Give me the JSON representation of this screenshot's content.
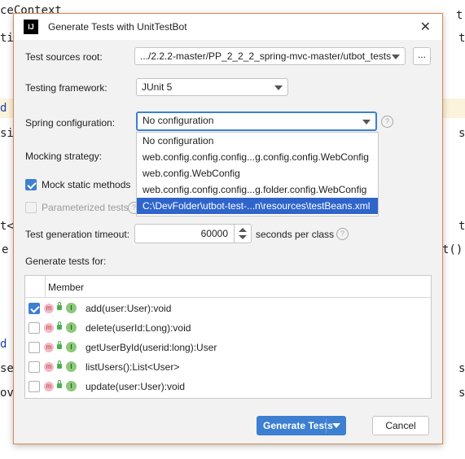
{
  "editor": {
    "fragments": [
      {
        "text": "ceContext"
      },
      {
        "text": "ti"
      },
      {
        "text": "d"
      },
      {
        "text": "si"
      },
      {
        "text": "t<"
      },
      {
        "text": "e"
      },
      {
        "text": "d"
      },
      {
        "text": "se"
      },
      {
        "text": "ov"
      },
      {
        "text": "t"
      },
      {
        "text": "t"
      },
      {
        "text": "s"
      },
      {
        "text": "t"
      },
      {
        "text": "t()"
      },
      {
        "text": "s"
      },
      {
        "text": "s"
      }
    ]
  },
  "dialog": {
    "title": "Generate Tests with UnitTestBot",
    "app_icon": "IJ",
    "close_glyph": "✕",
    "test_sources_root": {
      "label": "Test sources root:",
      "value": ".../2.2.2-master/PP_2_2_2_spring-mvc-master/utbot_tests",
      "browse_label": "..."
    },
    "testing_framework": {
      "label": "Testing framework:",
      "value": "JUnit 5"
    },
    "spring_configuration": {
      "label": "Spring configuration:",
      "value": "No configuration",
      "options": [
        {
          "label": "No configuration"
        },
        {
          "label": "web.config.config.config...g.config.config.WebConfig"
        },
        {
          "label": "web.config.WebConfig"
        },
        {
          "label": "web.config.config.config...g.folder.config.WebConfig"
        },
        {
          "label": "C:\\DevFolder\\utbot-test-...n\\resources\\testBeans.xml"
        }
      ]
    },
    "mocking_strategy": {
      "label": "Mocking strategy:"
    },
    "mock_static_methods": {
      "label": "Mock static methods",
      "checked": true
    },
    "parameterized_tests": {
      "label": "Parameterized tests",
      "checked": false,
      "enabled": false
    },
    "timeout": {
      "label": "Test generation timeout:",
      "value": "60000",
      "unit": "seconds per class"
    },
    "generate_for_label": "Generate tests for:",
    "table": {
      "header": "Member",
      "rows": [
        {
          "member": "add(user:User):void",
          "checked": true
        },
        {
          "member": "delete(userId:Long):void",
          "checked": false
        },
        {
          "member": "getUserById(userid:long):User",
          "checked": false
        },
        {
          "member": "listUsers():List<User>",
          "checked": false
        },
        {
          "member": "update(user:User):void",
          "checked": false
        }
      ],
      "method_badge": "m",
      "interface_badge": "I"
    },
    "generate_button": "Generate Tests",
    "cancel_button": "Cancel",
    "help_glyph": "?"
  }
}
